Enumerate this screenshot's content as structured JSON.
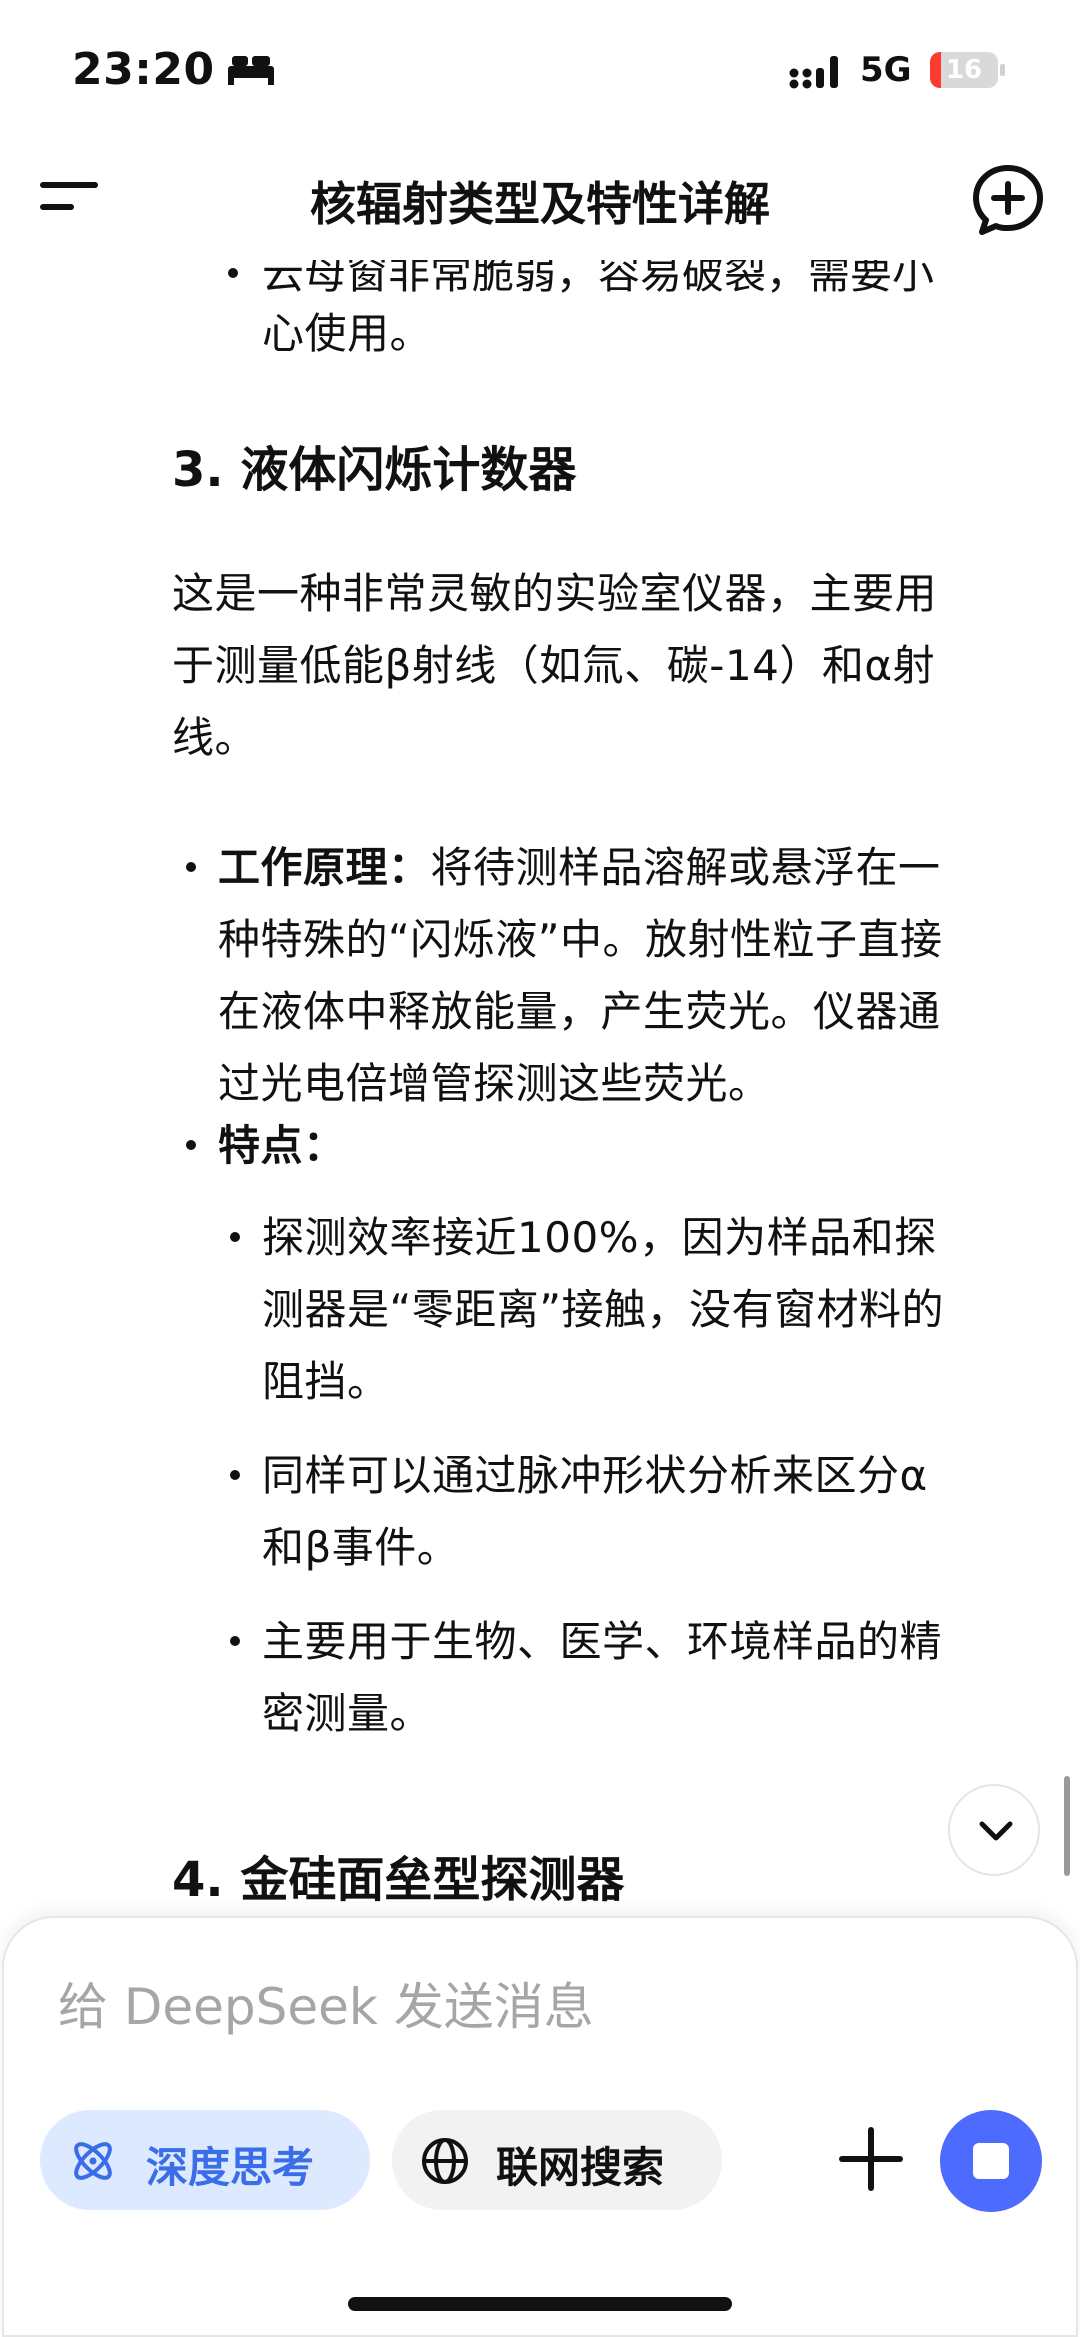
{
  "status_bar": {
    "time": "23:20",
    "network": "5G",
    "battery_level": "16",
    "battery_fraction": 0.16
  },
  "header": {
    "title": "核辐射类型及特性详解"
  },
  "content": {
    "cut_line": "云母窗非常脆弱，容易破裂，需要小",
    "cut_line_end": "心使用。",
    "section3": {
      "heading": "3. 液体闪烁计数器",
      "intro": [
        "这是一种非常灵敏的实验室仪器，主要用",
        "于测量低能β射线（如氚、碳-14）和α射",
        "线。"
      ],
      "principle_label": "工作原理：",
      "principle_lines": [
        "将待测样品溶解或悬浮在一",
        "种特殊的“闪烁液”中。放射性粒子直接",
        "在液体中释放能量，产生荧光。仪器通",
        "过光电倍增管探测这些荧光。"
      ],
      "features_label": "特点：",
      "features": [
        [
          "探测效率接近100%，因为样品和探",
          "测器是“零距离”接触，没有窗材料的",
          "阻挡。"
        ],
        [
          "同样可以通过脉冲形状分析来区分α",
          "和β事件。"
        ],
        [
          "主要用于生物、医学、环境样品的精",
          "密测量。"
        ]
      ]
    },
    "section4": {
      "heading": "4. 金硅面垒型探测器"
    }
  },
  "input": {
    "placeholder": "给 DeepSeek 发送消息",
    "deep_think_label": "深度思考",
    "web_search_label": "联网搜索"
  },
  "colors": {
    "accent": "#4d6bfe",
    "deep_think_bg": "#dce9ff",
    "deep_think_text": "#3a6de8",
    "battery_low": "#ff3b30"
  },
  "icons": [
    "bed-icon",
    "signal-icon",
    "battery-icon",
    "menu-icon",
    "new-chat-icon",
    "chevron-down-icon",
    "atom-icon",
    "globe-icon",
    "plus-icon",
    "stop-icon"
  ]
}
